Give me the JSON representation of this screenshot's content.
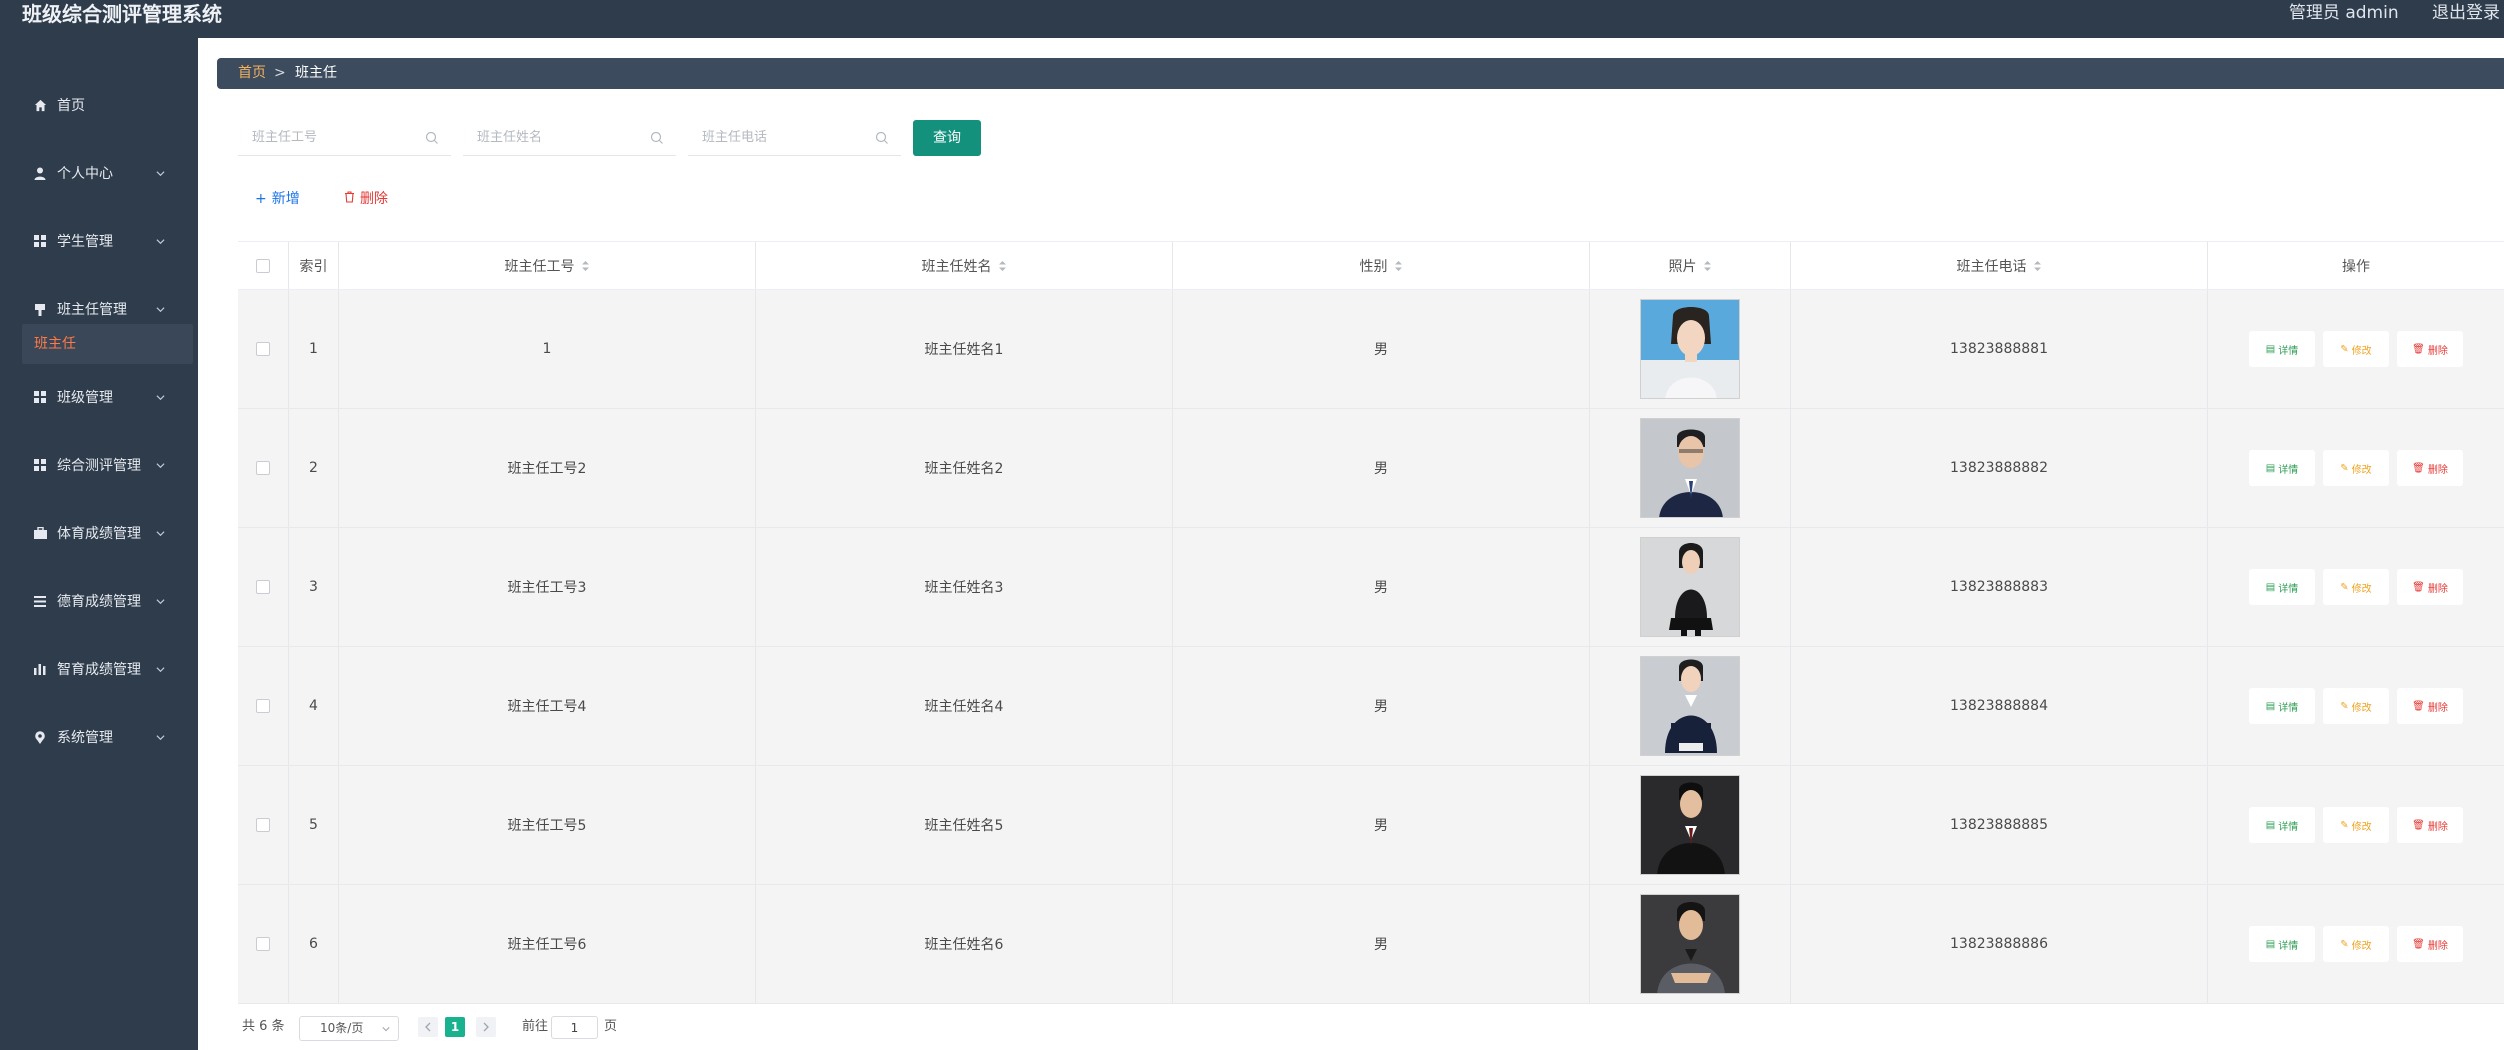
{
  "app": {
    "title": "班级综合测评管理系统",
    "user": "管理员 admin",
    "logout": "退出登录"
  },
  "sidebar": {
    "items": [
      {
        "label": "首页",
        "icon": "home-icon"
      },
      {
        "label": "个人中心",
        "icon": "user-icon"
      },
      {
        "label": "学生管理",
        "icon": "grid-icon"
      },
      {
        "label": "班主任管理",
        "icon": "flag-icon"
      },
      {
        "label": "班级管理",
        "icon": "grid-icon"
      },
      {
        "label": "综合测评管理",
        "icon": "grid-icon"
      },
      {
        "label": "体育成绩管理",
        "icon": "briefcase-icon"
      },
      {
        "label": "德育成绩管理",
        "icon": "list-icon"
      },
      {
        "label": "智育成绩管理",
        "icon": "bar-chart-icon"
      },
      {
        "label": "系统管理",
        "icon": "pin-icon"
      }
    ],
    "active_sub": "班主任"
  },
  "breadcrumb": {
    "home": "首页",
    "separator": ">",
    "current": "班主任"
  },
  "search": {
    "teacher_no_placeholder": "班主任工号",
    "teacher_name_placeholder": "班主任姓名",
    "teacher_phone_placeholder": "班主任电话",
    "query_label": "查询"
  },
  "actions": {
    "add_label": "新增",
    "delete_label": "删除"
  },
  "table": {
    "headers": {
      "index": "索引",
      "no": "班主任工号",
      "name": "班主任姓名",
      "gender": "性别",
      "photo": "照片",
      "phone": "班主任电话",
      "ops": "操作"
    },
    "rows": [
      {
        "index": "1",
        "no": "1",
        "name": "班主任姓名1",
        "gender": "男",
        "phone": "13823888881"
      },
      {
        "index": "2",
        "no": "班主任工号2",
        "name": "班主任姓名2",
        "gender": "男",
        "phone": "13823888882"
      },
      {
        "index": "3",
        "no": "班主任工号3",
        "name": "班主任姓名3",
        "gender": "男",
        "phone": "13823888883"
      },
      {
        "index": "4",
        "no": "班主任工号4",
        "name": "班主任姓名4",
        "gender": "男",
        "phone": "13823888884"
      },
      {
        "index": "5",
        "no": "班主任工号5",
        "name": "班主任姓名5",
        "gender": "男",
        "phone": "13823888885"
      },
      {
        "index": "6",
        "no": "班主任工号6",
        "name": "班主任姓名6",
        "gender": "男",
        "phone": "13823888886"
      }
    ],
    "op_labels": {
      "detail": "详情",
      "edit": "修改",
      "delete": "删除"
    }
  },
  "pagination": {
    "total": "共 6 条",
    "page_size": "10条/页",
    "current_page": "1",
    "goto": "前往",
    "goto_value": "1",
    "page_suffix": "页"
  },
  "colors": {
    "sidebar_bg": "#2f3c4b",
    "accent": "#13917d",
    "active_menu": "#ff7a45",
    "breadcrumb_home": "#f2b25e"
  }
}
